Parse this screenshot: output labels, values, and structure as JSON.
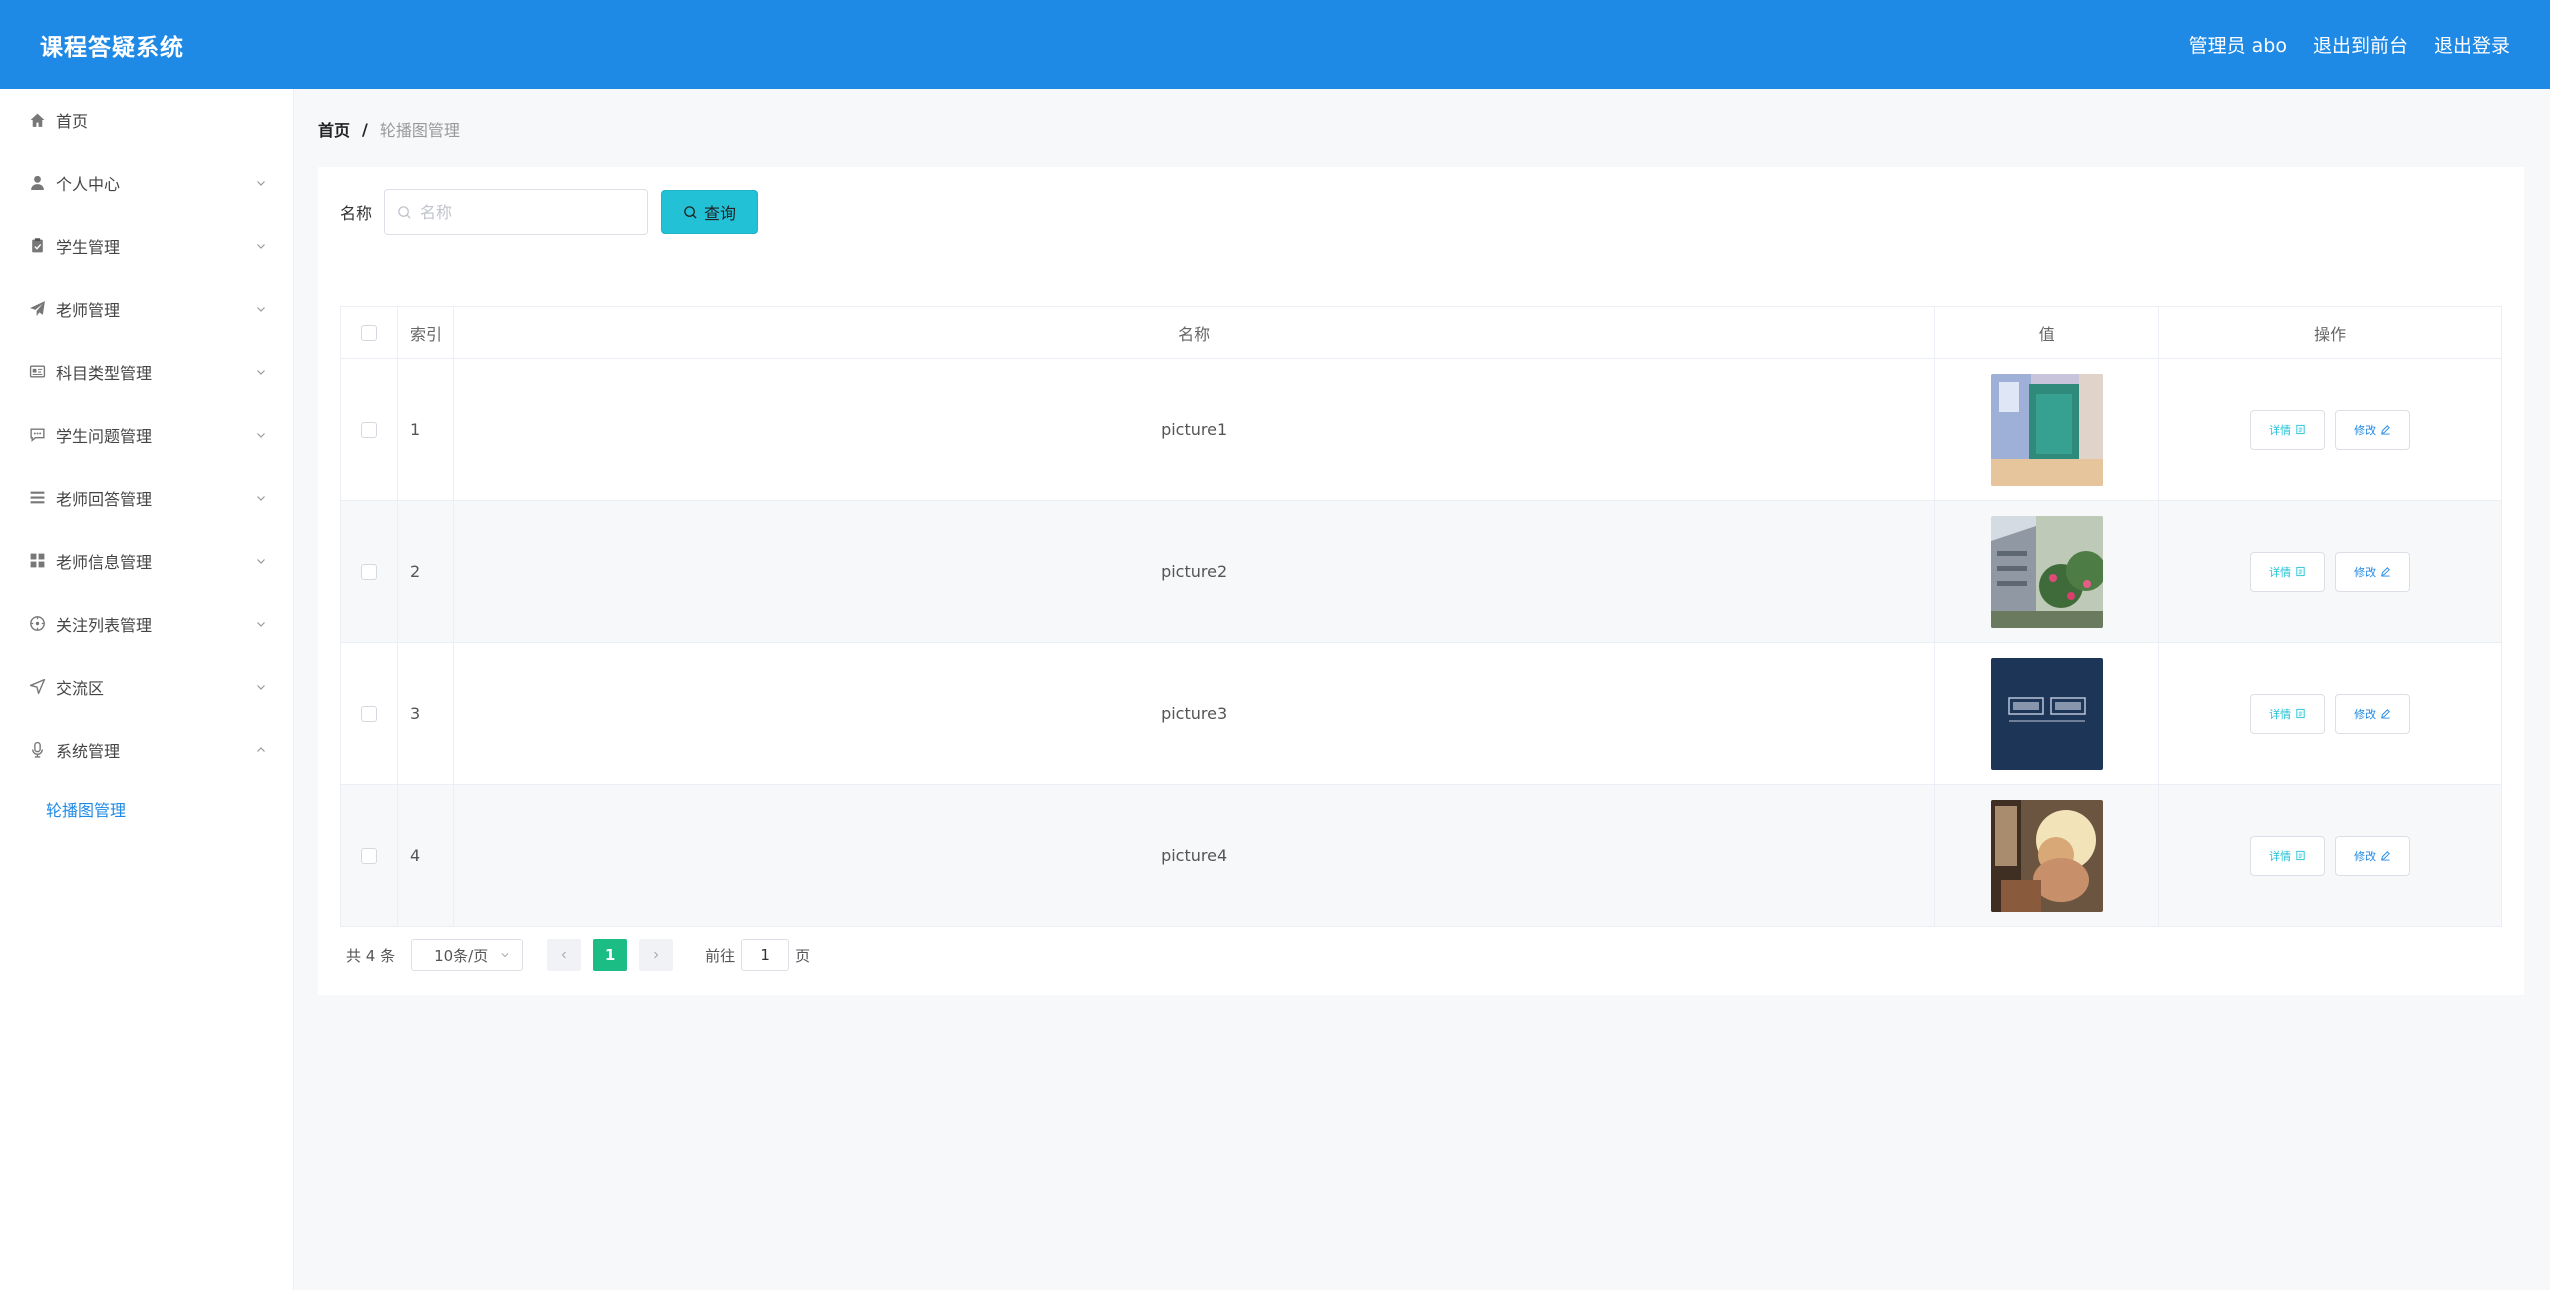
{
  "header": {
    "title": "课程答疑系统",
    "user": "管理员 abo",
    "to_front": "退出到前台",
    "logout": "退出登录",
    "bg_color": "#1f89e6"
  },
  "sidebar": {
    "items": [
      {
        "label": "首页",
        "icon": "home-icon"
      },
      {
        "label": "个人中心",
        "icon": "user-icon"
      },
      {
        "label": "学生管理",
        "icon": "clipboard-icon"
      },
      {
        "label": "老师管理",
        "icon": "send-icon"
      },
      {
        "label": "科目类型管理",
        "icon": "id-card-icon"
      },
      {
        "label": "学生问题管理",
        "icon": "chat-icon"
      },
      {
        "label": "老师回答管理",
        "icon": "list-icon"
      },
      {
        "label": "老师信息管理",
        "icon": "grid-icon"
      },
      {
        "label": "关注列表管理",
        "icon": "dial-icon"
      },
      {
        "label": "交流区",
        "icon": "location-icon"
      },
      {
        "label": "系统管理",
        "icon": "microphone-icon"
      }
    ],
    "sub_item": "轮播图管理",
    "accent_color": "#1f89e6"
  },
  "breadcrumb": {
    "home": "首页",
    "separator": "/",
    "current": "轮播图管理"
  },
  "search": {
    "label": "名称",
    "placeholder": "名称",
    "value": "",
    "button": "查询",
    "button_color": "#22c1d6"
  },
  "table": {
    "headers": {
      "index": "索引",
      "name": "名称",
      "value": "值",
      "actions": "操作"
    },
    "rows": [
      {
        "index": "1",
        "name": "picture1",
        "detail": "详情",
        "edit": "修改"
      },
      {
        "index": "2",
        "name": "picture2",
        "detail": "详情",
        "edit": "修改"
      },
      {
        "index": "3",
        "name": "picture3",
        "detail": "详情",
        "edit": "修改"
      },
      {
        "index": "4",
        "name": "picture4",
        "detail": "详情",
        "edit": "修改"
      }
    ]
  },
  "pagination": {
    "total": "共 4 条",
    "page_size": "10条/页",
    "current_page": "1",
    "goto_label": "前往",
    "goto_value": "1",
    "page_label": "页",
    "active_color": "#1bbd84"
  }
}
